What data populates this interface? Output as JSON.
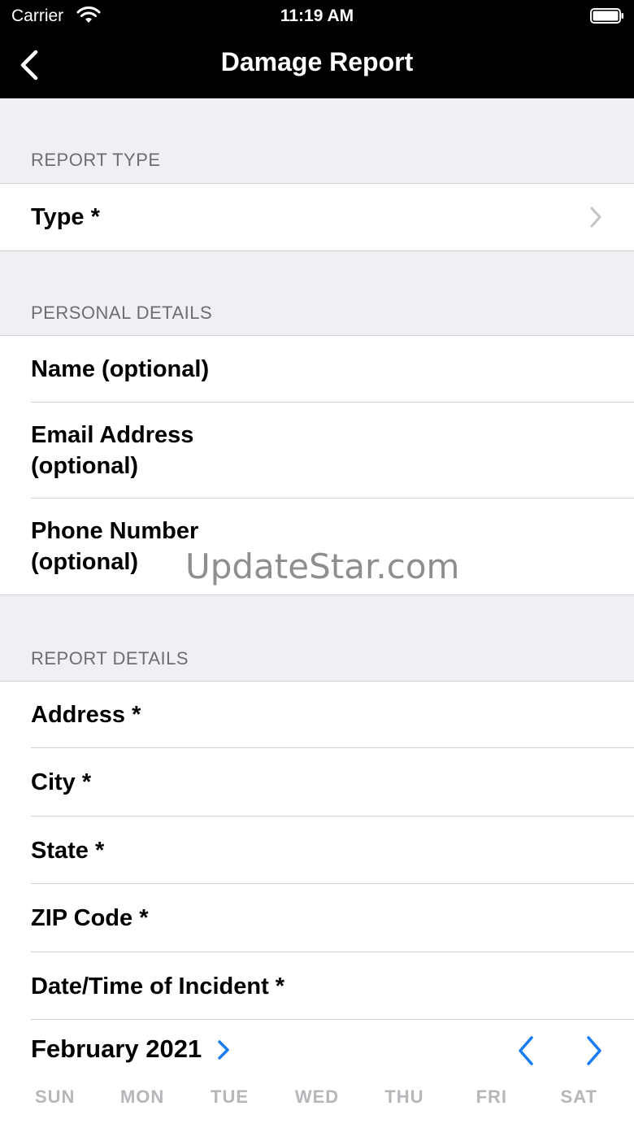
{
  "status_bar": {
    "carrier": "Carrier",
    "time": "11:19 AM"
  },
  "nav": {
    "title": "Damage Report",
    "back_icon": "chevron-left-icon"
  },
  "sections": {
    "report_type": {
      "header": "REPORT TYPE",
      "rows": [
        {
          "label": "Type *",
          "has_chevron": true
        }
      ]
    },
    "personal_details": {
      "header": "PERSONAL DETAILS",
      "rows": [
        {
          "label": "Name (optional)"
        },
        {
          "label": "Email Address (optional)"
        },
        {
          "label": "Phone Number (optional)"
        }
      ]
    },
    "report_details": {
      "header": "REPORT DETAILS",
      "rows": [
        {
          "label": "Address *"
        },
        {
          "label": "City *"
        },
        {
          "label": "State *"
        },
        {
          "label": "ZIP Code *"
        },
        {
          "label": "Date/Time of Incident *"
        }
      ]
    }
  },
  "watermark": "UpdateStar.com",
  "calendar": {
    "month": "February 2021",
    "weekdays": [
      "SUN",
      "MON",
      "TUE",
      "WED",
      "THU",
      "FRI",
      "SAT"
    ],
    "accent": "#1a7cf5"
  }
}
